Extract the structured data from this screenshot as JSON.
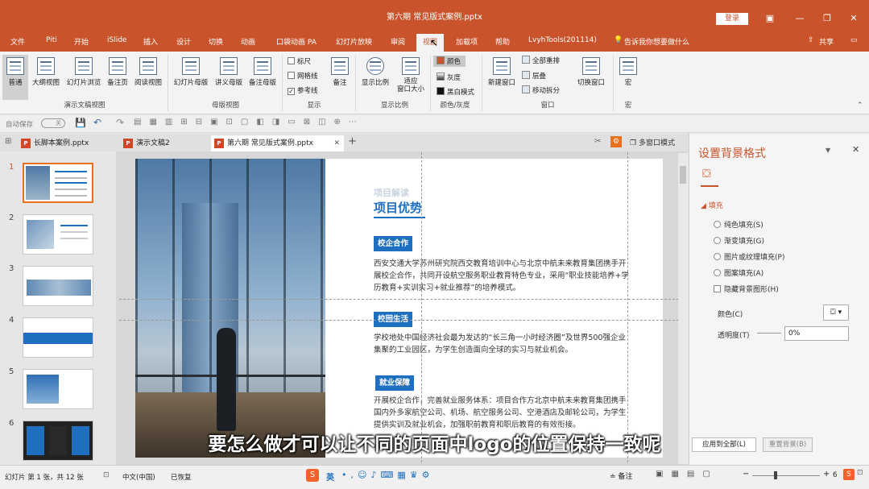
{
  "window": {
    "title": "第六期 常见版式案例.pptx",
    "login": "登录"
  },
  "tabs": [
    "文件",
    "Piti",
    "开始",
    "iSlide",
    "插入",
    "设计",
    "切换",
    "动画",
    "口袋动画 PA",
    "幻灯片放映",
    "审阅",
    "视图",
    "加载项",
    "帮助",
    "LvyhTools(201114)"
  ],
  "tell_me": "告诉我你想要做什么",
  "share": "共享",
  "ribbon": {
    "pres_views": [
      "普通",
      "大纲视图",
      "幻灯片浏览",
      "备注页",
      "阅读视图"
    ],
    "pres_views_label": "演示文稿视图",
    "master_views": [
      "幻灯片母版",
      "讲义母版",
      "备注母版"
    ],
    "master_views_label": "母版视图",
    "show": {
      "ruler": "标尺",
      "gridlines": "网格线",
      "guides": "参考线",
      "notes": "备注",
      "label": "显示"
    },
    "zoom": {
      "zoom": "显示比例",
      "fit": "适应\n窗口大小",
      "label": "显示比例"
    },
    "color": {
      "color": "颜色",
      "gray": "灰度",
      "bw": "黑白模式",
      "label": "颜色/灰度"
    },
    "window": {
      "new": "新建窗口",
      "arrange": "全部重排",
      "cascade": "层叠",
      "move_split": "移动拆分",
      "switch": "切换窗口",
      "label": "窗口"
    },
    "macro": {
      "macro": "宏",
      "label": "宏"
    }
  },
  "qat": {
    "autosave": "自动保存",
    "off": "关"
  },
  "doc_tabs": [
    "长脚本案例.pptx",
    "演示文稿2",
    "第六期 常见版式案例.pptx"
  ],
  "multi_window": "多窗口模式",
  "thumbnails": [
    "1",
    "2",
    "3",
    "4",
    "5",
    "6"
  ],
  "slide": {
    "eyebrow": "项目解读",
    "heading": "项目优势",
    "s1_title": "校企合作",
    "s1_body": "西安交通大学苏州研究院西交教育培训中心与北京中航未来教育集团携手开展校企合作，共同开设航空服务职业教育特色专业，采用“职业技能培养+学历教育+实训实习+就业推荐”的培养模式。",
    "s2_title": "校园生活",
    "s2_body": "学校地处中国经济社会最为发达的“长三角一小时经济圈”及世界500强企业集聚的工业园区，为学生创造面向全球的实习与就业机会。",
    "s3_title": "就业保障",
    "s3_body": "开展校企合作，完善就业服务体系：项目合作方北京中航未来教育集团携手国内外多家航空公司、机场、航空服务公司、空港酒店及邮轮公司，为学生提供实训及就业机会，加强职前教育和职后教育的有效衔接。"
  },
  "pane": {
    "title": "设置背景格式",
    "fill": "填充",
    "options": [
      "纯色填充(S)",
      "渐变填充(G)",
      "图片或纹理填充(P)",
      "图案填充(A)"
    ],
    "hide_bg": "隐藏背景图形(H)",
    "color_label": "颜色(C)",
    "transparency_label": "透明度(T)",
    "transparency_value": "0%",
    "apply_all": "应用到全部(L)",
    "reset": "重置背景(B)"
  },
  "status": {
    "slide_info": "幻灯片 第 1 张，共 12 张",
    "lang": "中文(中国)",
    "recovered": "已恢复",
    "notes": "备注",
    "zoom_value": "6"
  },
  "ime": "英",
  "subtitle": "要怎么做才可以让不同的页面中logo的位置保持一致呢",
  "colors": {
    "accent": "#c9542c",
    "blue": "#1e6fbf"
  }
}
